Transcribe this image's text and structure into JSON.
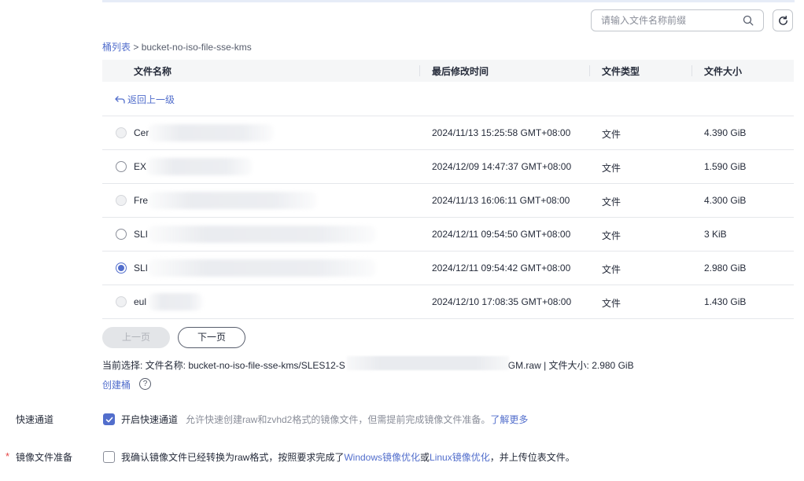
{
  "search": {
    "placeholder": "请输入文件名称前缀"
  },
  "breadcrumb": {
    "root": "桶列表",
    "separator": " > ",
    "current": "bucket-no-iso-file-sse-kms"
  },
  "table": {
    "columns": [
      "文件名称",
      "最后修改时间",
      "文件类型",
      "文件大小"
    ],
    "back_label": "返回上一级",
    "rows": [
      {
        "name": "Cer",
        "modified": "2024/11/13 15:25:58 GMT+08:00",
        "type": "文件",
        "size": "4.390 GiB",
        "state": "disabled"
      },
      {
        "name": "EX",
        "modified": "2024/12/09 14:47:37 GMT+08:00",
        "type": "文件",
        "size": "1.590 GiB",
        "state": "enabled"
      },
      {
        "name": "Fre",
        "modified": "2024/11/13 16:06:11 GMT+08:00",
        "type": "文件",
        "size": "4.300 GiB",
        "state": "disabled"
      },
      {
        "name": "SLI",
        "modified": "2024/12/11 09:54:50 GMT+08:00",
        "type": "文件",
        "size": "3 KiB",
        "state": "enabled"
      },
      {
        "name": "SLI",
        "modified": "2024/12/11 09:54:42 GMT+08:00",
        "type": "文件",
        "size": "2.980 GiB",
        "state": "checked"
      },
      {
        "name": "eul",
        "modified": "2024/12/10 17:08:35 GMT+08:00",
        "type": "文件",
        "size": "1.430 GiB",
        "state": "disabled"
      }
    ]
  },
  "pagination": {
    "prev": "上一页",
    "next": "下一页"
  },
  "selection": {
    "prefix": "当前选择: 文件名称:  bucket-no-iso-file-sse-kms/SLES12-S",
    "suffix": "GM.raw | 文件大小: 2.980 GiB"
  },
  "create_bucket": "创建桶",
  "help_icon_text": "?",
  "fast_channel": {
    "label": "快速通道",
    "checkbox_label": "开启快速通道",
    "checked": true,
    "hint": "允许快速创建raw和zvhd2格式的镜像文件，但需提前完成镜像文件准备。",
    "learn_more": "了解更多"
  },
  "image_prep": {
    "required_mark": "*",
    "label": "镜像文件准备",
    "checked": false,
    "text_before": "我确认镜像文件已经转换为raw格式，按照要求完成了",
    "link_windows": "Windows镜像优化",
    "text_mid": "或",
    "link_linux": "Linux镜像优化",
    "text_after": "，并上传位表文件。"
  },
  "colors": {
    "accent": "#526ecc",
    "text": "#252b3a",
    "muted": "#8a8e99",
    "required": "#e54545"
  }
}
